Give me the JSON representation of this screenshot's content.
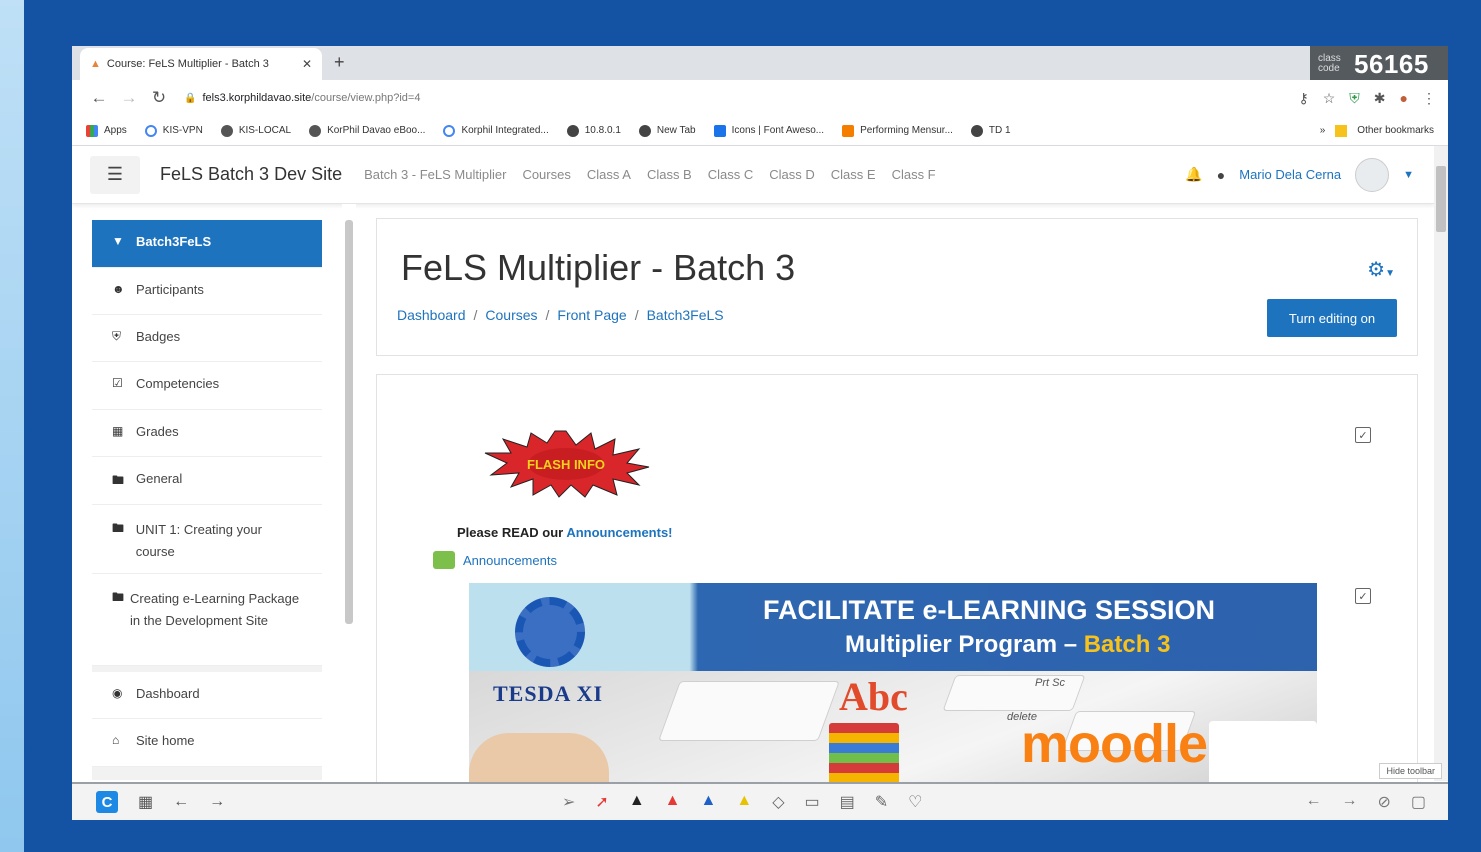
{
  "class_code": {
    "label": "class code",
    "number": "56165"
  },
  "browser": {
    "tab_title": "Course: FeLS Multiplier - Batch 3",
    "url_domain": "fels3.korphildavao.site",
    "url_path": "/course/view.php?id=4",
    "bookmarks": [
      "Apps",
      "KIS-VPN",
      "KIS-LOCAL",
      "KorPhil Davao eBoo...",
      "Korphil Integrated...",
      "10.8.0.1",
      "New Tab",
      "Icons | Font Aweso...",
      "Performing Mensur...",
      "TD 1"
    ],
    "other_bookmarks": "Other bookmarks"
  },
  "navbar": {
    "site_name": "FeLS Batch 3 Dev Site",
    "links": [
      "Batch 3 - FeLS Multiplier",
      "Courses",
      "Class A",
      "Class B",
      "Class C",
      "Class D",
      "Class E",
      "Class F"
    ],
    "user_name": "Mario Dela Cerna"
  },
  "sidebar": {
    "items": [
      {
        "label": "Batch3FeLS",
        "icon": "graduation-cap-icon"
      },
      {
        "label": "Participants",
        "icon": "users-icon"
      },
      {
        "label": "Badges",
        "icon": "shield-icon"
      },
      {
        "label": "Competencies",
        "icon": "check-square-icon"
      },
      {
        "label": "Grades",
        "icon": "table-icon"
      },
      {
        "label": "General",
        "icon": "folder-icon"
      },
      {
        "label": "UNIT 1: Creating your course",
        "icon": "folder-icon"
      },
      {
        "label": "Creating e-Learning Package in the Development Site",
        "icon": "folder-icon"
      },
      {
        "label": "Dashboard",
        "icon": "dashboard-icon"
      },
      {
        "label": "Site home",
        "icon": "home-icon"
      }
    ]
  },
  "header": {
    "course_title": "FeLS Multiplier - Batch 3",
    "breadcrumb": [
      "Dashboard",
      "Courses",
      "Front Page",
      "Batch3FeLS"
    ],
    "edit_button": "Turn editing on"
  },
  "content": {
    "flash_text": "FLASH INFO",
    "read_prefix": "Please READ our",
    "read_link": "Announcements!",
    "announcements_link": "Announcements",
    "banner": {
      "line1": "FACILITATE e-LEARNING SESSION",
      "line2_prefix": "Multiplier Program –",
      "line2_highlight": "Batch 3",
      "org_logo_text": "TESDA XI",
      "moodle_text": "moodle",
      "key_labels": [
        "delete",
        "Prt Sc",
        "Abc"
      ]
    }
  },
  "toolbar": {
    "hide_label": "Hide toolbar"
  },
  "colors": {
    "accent": "#1e73be",
    "frame": "#1452a3",
    "batch_highlight": "#f6c21b"
  }
}
